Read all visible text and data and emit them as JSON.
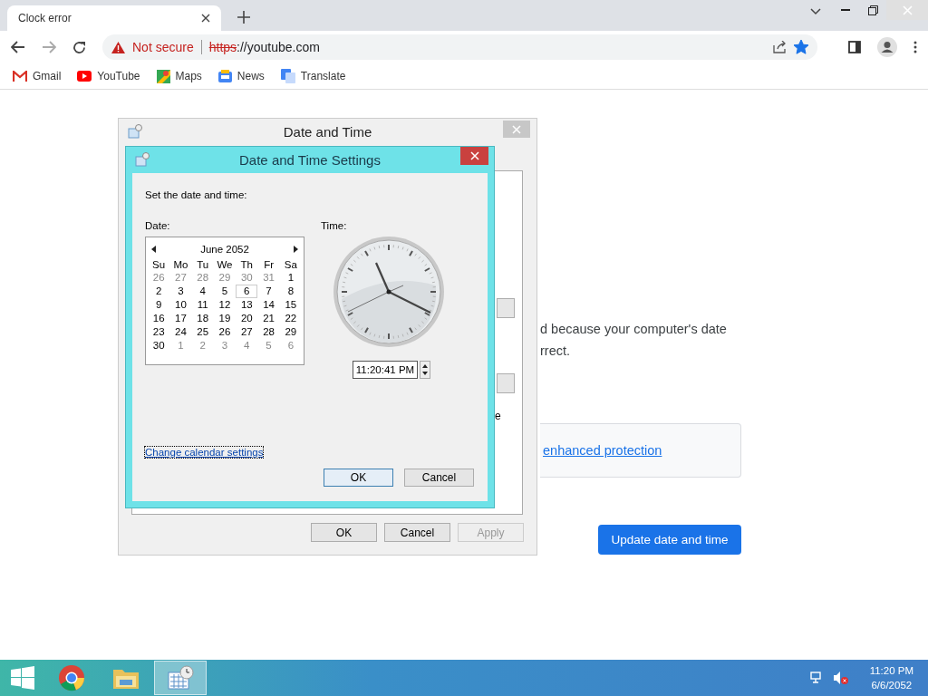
{
  "browser": {
    "tabs": [
      {
        "title": "Clock error",
        "selected": true
      }
    ],
    "address": {
      "security": "Not secure",
      "scheme": "https",
      "rest": "://youtube.com",
      "bookmarked": true
    },
    "bookmarks": [
      {
        "label": "Gmail",
        "kind": "gmail"
      },
      {
        "label": "YouTube",
        "kind": "youtube"
      },
      {
        "label": "Maps",
        "kind": "maps"
      },
      {
        "label": "News",
        "kind": "news"
      },
      {
        "label": "Translate",
        "kind": "translate"
      }
    ],
    "page": {
      "text_lines": [
        "d because your computer's date",
        "rrect."
      ],
      "link": "enhanced protection",
      "button": "Update date and time"
    }
  },
  "outer_dialog": {
    "title": "Date and Time",
    "fragment": "e",
    "buttons": [
      {
        "label": "OK",
        "disabled": false
      },
      {
        "label": "Cancel",
        "disabled": false
      },
      {
        "label": "Apply",
        "disabled": true
      }
    ]
  },
  "inner_dialog": {
    "title": "Date and Time Settings",
    "prompt": "Set the date and time:",
    "date_label": "Date:",
    "time_label": "Time:",
    "calendar": {
      "month": "June 2052",
      "weekdays": [
        "Su",
        "Mo",
        "Tu",
        "We",
        "Th",
        "Fr",
        "Sa"
      ],
      "weeks": [
        [
          {
            "day": "26",
            "in_month": false,
            "selected": false
          },
          {
            "day": "27",
            "in_month": false,
            "selected": false
          },
          {
            "day": "28",
            "in_month": false,
            "selected": false
          },
          {
            "day": "29",
            "in_month": false,
            "selected": false
          },
          {
            "day": "30",
            "in_month": false,
            "selected": false
          },
          {
            "day": "31",
            "in_month": false,
            "selected": false
          },
          {
            "day": "1",
            "in_month": true,
            "selected": false
          }
        ],
        [
          {
            "day": "2",
            "in_month": true,
            "selected": false
          },
          {
            "day": "3",
            "in_month": true,
            "selected": false
          },
          {
            "day": "4",
            "in_month": true,
            "selected": false
          },
          {
            "day": "5",
            "in_month": true,
            "selected": false
          },
          {
            "day": "6",
            "in_month": true,
            "selected": true
          },
          {
            "day": "7",
            "in_month": true,
            "selected": false
          },
          {
            "day": "8",
            "in_month": true,
            "selected": false
          }
        ],
        [
          {
            "day": "9",
            "in_month": true,
            "selected": false
          },
          {
            "day": "10",
            "in_month": true,
            "selected": false
          },
          {
            "day": "11",
            "in_month": true,
            "selected": false
          },
          {
            "day": "12",
            "in_month": true,
            "selected": false
          },
          {
            "day": "13",
            "in_month": true,
            "selected": false
          },
          {
            "day": "14",
            "in_month": true,
            "selected": false
          },
          {
            "day": "15",
            "in_month": true,
            "selected": false
          }
        ],
        [
          {
            "day": "16",
            "in_month": true,
            "selected": false
          },
          {
            "day": "17",
            "in_month": true,
            "selected": false
          },
          {
            "day": "18",
            "in_month": true,
            "selected": false
          },
          {
            "day": "19",
            "in_month": true,
            "selected": false
          },
          {
            "day": "20",
            "in_month": true,
            "selected": false
          },
          {
            "day": "21",
            "in_month": true,
            "selected": false
          },
          {
            "day": "22",
            "in_month": true,
            "selected": false
          }
        ],
        [
          {
            "day": "23",
            "in_month": true,
            "selected": false
          },
          {
            "day": "24",
            "in_month": true,
            "selected": false
          },
          {
            "day": "25",
            "in_month": true,
            "selected": false
          },
          {
            "day": "26",
            "in_month": true,
            "selected": false
          },
          {
            "day": "27",
            "in_month": true,
            "selected": false
          },
          {
            "day": "28",
            "in_month": true,
            "selected": false
          },
          {
            "day": "29",
            "in_month": true,
            "selected": false
          }
        ],
        [
          {
            "day": "30",
            "in_month": true,
            "selected": false
          },
          {
            "day": "1",
            "in_month": false,
            "selected": false
          },
          {
            "day": "2",
            "in_month": false,
            "selected": false
          },
          {
            "day": "3",
            "in_month": false,
            "selected": false
          },
          {
            "day": "4",
            "in_month": false,
            "selected": false
          },
          {
            "day": "5",
            "in_month": false,
            "selected": false
          },
          {
            "day": "6",
            "in_month": false,
            "selected": false
          }
        ]
      ]
    },
    "time_value": "11:20:41 PM",
    "link": "Change calendar settings",
    "buttons": [
      {
        "label": "OK",
        "default": true
      },
      {
        "label": "Cancel",
        "default": false
      }
    ]
  },
  "taskbar": {
    "apps": [
      {
        "kind": "chrome",
        "selected": false
      },
      {
        "kind": "explorer",
        "selected": false
      },
      {
        "kind": "datetime",
        "selected": true
      }
    ],
    "time": "11:20 PM",
    "date": "6/6/2052"
  }
}
